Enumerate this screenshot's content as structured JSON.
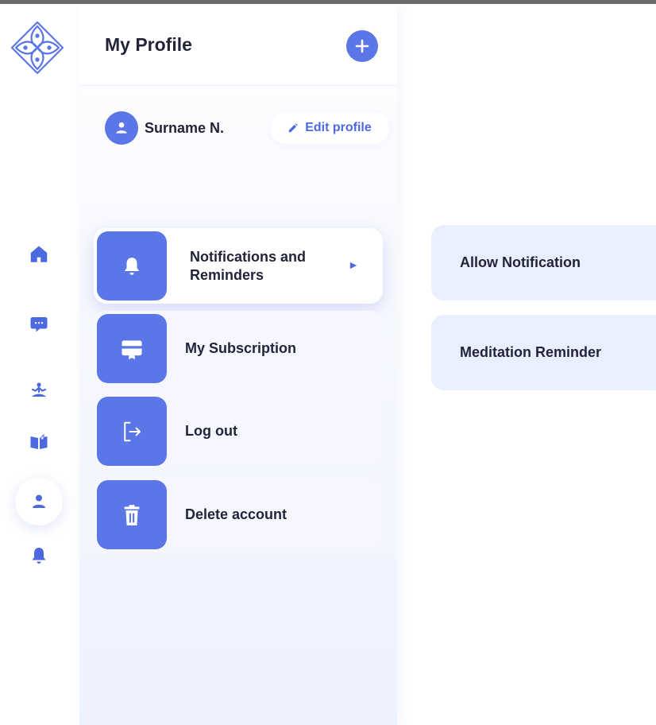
{
  "nav": {
    "items": [
      {
        "name": "home",
        "icon": "home-icon",
        "active": false
      },
      {
        "name": "chat",
        "icon": "chat-icon",
        "active": false
      },
      {
        "name": "meditation",
        "icon": "meditation-icon",
        "active": false
      },
      {
        "name": "library",
        "icon": "book-icon",
        "active": false
      },
      {
        "name": "profile",
        "icon": "user-icon",
        "active": true
      },
      {
        "name": "notifications",
        "icon": "bell-icon",
        "active": false
      }
    ]
  },
  "profile": {
    "title": "My Profile",
    "user_name": "Surname N.",
    "edit_label": "Edit profile"
  },
  "menu": {
    "items": [
      {
        "label": "Notifications and Reminders",
        "icon": "bell-icon"
      },
      {
        "label": "My Subscription",
        "icon": "subscription-card-icon"
      },
      {
        "label": "Log out",
        "icon": "logout-icon"
      },
      {
        "label": "Delete account",
        "icon": "trash-icon"
      }
    ]
  },
  "settings": {
    "items": [
      {
        "label": "Allow Notification"
      },
      {
        "label": "Meditation Reminder"
      }
    ]
  },
  "colors": {
    "accent": "#5b76e6",
    "text": "#23243a",
    "card_bg": "#f6f7fe",
    "setting_bg": "#eaeffd"
  }
}
